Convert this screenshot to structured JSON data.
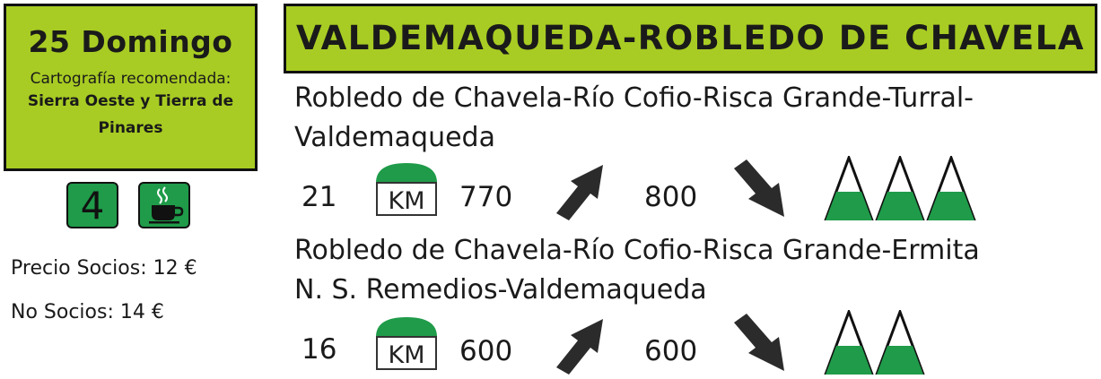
{
  "date_box": {
    "title": "25 Domingo",
    "cartography_label": "Cartografía recomendada:",
    "cartography_value": "Sierra Oeste y Tierra de Pinares"
  },
  "badges": {
    "level": "4",
    "cup_icon": "coffee-cup-icon"
  },
  "prices": {
    "members": "Precio Socios: 12 €",
    "non_members": "No Socios: 14 €"
  },
  "header": {
    "title": "VALDEMAQUEDA-ROBLEDO DE CHAVELA"
  },
  "routes": [
    {
      "line1": "Robledo de Chavela-Río Cofio-Risca Grande-Turral-",
      "line2": "Valdemaqueda",
      "distance": "21",
      "km_label": "KM",
      "ascent": "770",
      "descent": "800",
      "difficulty": 3
    },
    {
      "line1": "Robledo de Chavela-Río Cofio-Risca Grande-Ermita",
      "line2": "N. S. Remedios-Valdemaqueda",
      "distance": "16",
      "km_label": "KM",
      "ascent": "600",
      "descent": "600",
      "difficulty": 2
    }
  ],
  "colors": {
    "accent": "#a8cc23",
    "green": "#1f9b49",
    "dark": "#2b2b2b"
  }
}
